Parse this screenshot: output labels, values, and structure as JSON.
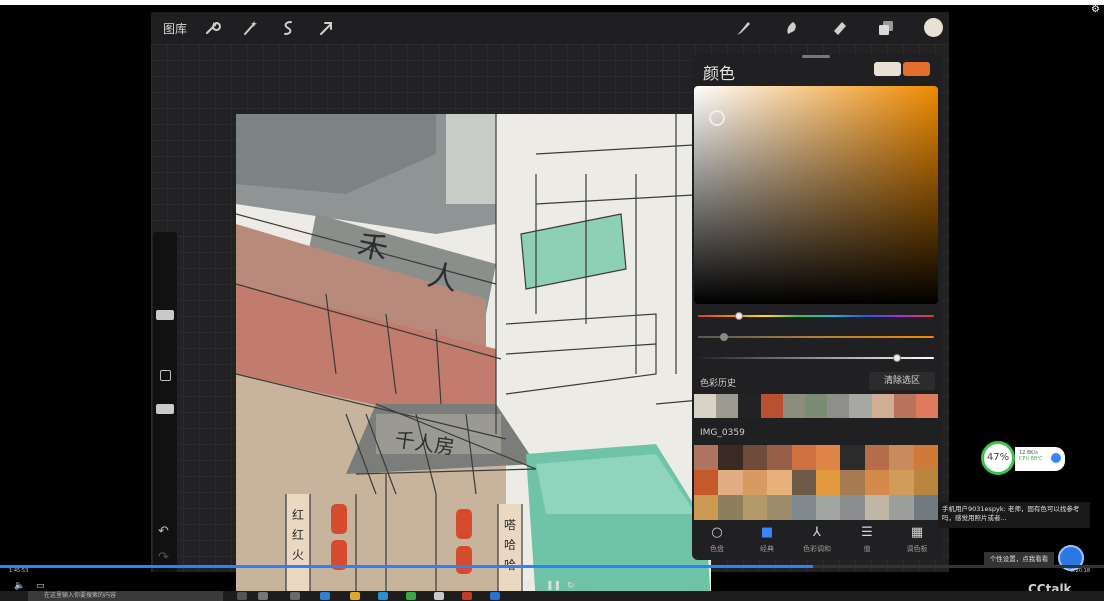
{
  "toolbar": {
    "gallery_label": "图库",
    "left_icons": [
      "wrench-icon",
      "magic-wand-icon",
      "selection-icon",
      "transform-arrow-icon"
    ],
    "right_icons": [
      "brush-icon",
      "smudge-icon",
      "eraser-icon",
      "layers-icon",
      "color-circle-icon"
    ]
  },
  "colors": {
    "current_color": "#e9e1d6",
    "previous_color": "#e2702a",
    "hue_accent": "#f08a00"
  },
  "color_panel": {
    "title": "颜色",
    "history_label": "色彩历史",
    "clear_button": "清除选区",
    "palette_label": "IMG_0359",
    "history_swatches": [
      "#d7d3c7",
      "#9d9a8f",
      "#222222",
      "#b9502f",
      "#8c8c7f",
      "#7a8c74",
      "#8e8e8a",
      "#a7a7a4",
      "#cfae95",
      "#b7735c",
      "#e07a5e"
    ],
    "palette_swatches": [
      "#ad7461",
      "#3a2a24",
      "#6e4b3b",
      "#965f48",
      "#cf7242",
      "#e0854a",
      "#2b2b2b",
      "#b66d49",
      "#c98a5c",
      "#d07a3a",
      "#c45a2a",
      "#e2ad84",
      "#d79a5f",
      "#e8b07b",
      "#6d5a49",
      "#e29a3c",
      "#a77b52",
      "#d48a4a",
      "#d19b5a",
      "#b8863f",
      "#c99a50",
      "#8d7f5c",
      "#b39a6a",
      "#9c8c6b",
      "#7f8a8f",
      "#a1a6a2",
      "#8c8d8e",
      "#bfb7a3",
      "#9d9f9c",
      "#707a7f"
    ],
    "tabs": [
      {
        "label": "色盘",
        "icon": "disc-icon"
      },
      {
        "label": "经典",
        "icon": "classic-square-icon"
      },
      {
        "label": "色彩调和",
        "icon": "harmony-icon"
      },
      {
        "label": "值",
        "icon": "value-sliders-icon"
      },
      {
        "label": "调色板",
        "icon": "palette-grid-icon"
      }
    ]
  },
  "overlay": {
    "speed_percent": "47%",
    "net_speed": "12.8K/s",
    "cpu_label": "CPU 88℃",
    "chat_message": "手机用户9031espyk: 老师，固有色可以找参考吗，感觉用照片或者...",
    "personal_settings": "个性设置，点我看看"
  },
  "player": {
    "time_elapsed": "1:45:53",
    "time_total": "2:20:18",
    "progress": 0.736,
    "search_placeholder": "在这里输入你要搜索的内容",
    "brand": "CCtalk"
  }
}
